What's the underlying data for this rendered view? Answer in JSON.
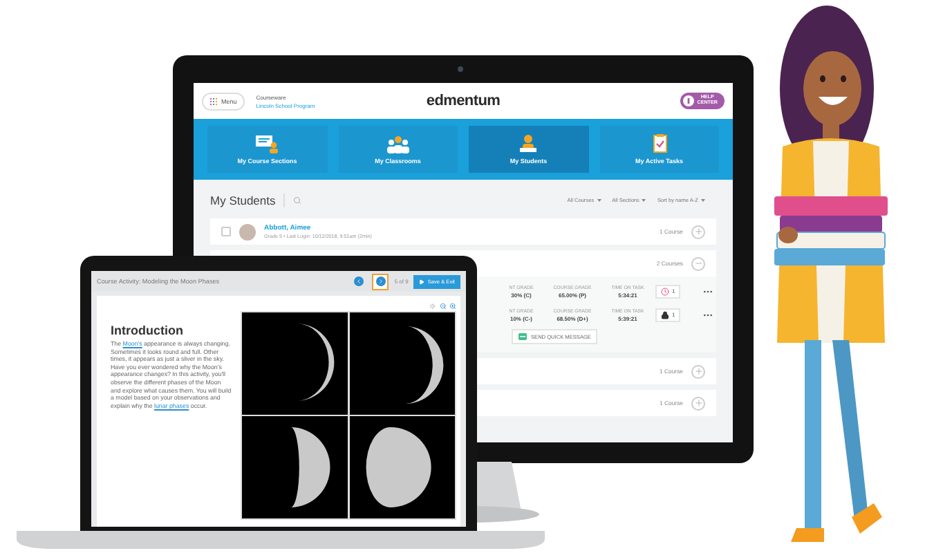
{
  "monitor": {
    "header": {
      "menu_label": "Menu",
      "context_title": "Courseware",
      "context_link": "Lincoln School Program",
      "logo": "edmentum",
      "help_lines": [
        "HELP",
        "CENTER"
      ]
    },
    "nav_tiles": [
      {
        "label": "My Course Sections",
        "kind": "sections",
        "selected": false
      },
      {
        "label": "My Classrooms",
        "kind": "classrooms",
        "selected": false
      },
      {
        "label": "My Students",
        "kind": "students",
        "selected": true
      },
      {
        "label": "My Active Tasks",
        "kind": "tasks",
        "selected": false
      }
    ],
    "section_title": "My Students",
    "filters": [
      "All Courses",
      "All Sections",
      "Sort by name A-Z"
    ],
    "students": [
      {
        "name": "Abbott, Aimee",
        "checked": false,
        "details": "Grade 5 • Last Login: 10/12/2018, 9:51am (2min)",
        "courses": "1 Course",
        "expanded": false
      },
      {
        "courses": "2 Courses",
        "expanded": true,
        "course_rows": [
          {
            "current_header": "NT GRADE",
            "current": "30% (C)",
            "course_header": "COURSE GRADE",
            "course": "65.00% (P)",
            "time_header": "TIME ON TASK",
            "time": "5:34:21",
            "kind": "clock",
            "badge_count": "1"
          },
          {
            "current_header": "NT GRADE",
            "current": "10% (C-)",
            "course_header": "COURSE GRADE",
            "course": "68.50% (D+)",
            "time_header": "TIME ON TASK",
            "time": "5:39:21",
            "kind": "lock",
            "badge_count": "1"
          }
        ],
        "action": "SEND QUICK MESSAGE"
      },
      {
        "courses": "1 Course",
        "expanded": false
      },
      {
        "courses": "1 Course",
        "expanded": false
      }
    ]
  },
  "laptop": {
    "title": "Course Activity: Modeling the Moon Phases",
    "nav_buttons": [
      {
        "kind": "prev",
        "focused": false
      },
      {
        "kind": "next",
        "focused": true
      }
    ],
    "page": "5 of 9",
    "save_label": "Save & Exit",
    "heading": "Introduction",
    "paragraph": [
      {
        "kind": "text",
        "text": "The "
      },
      {
        "kind": "link",
        "text": "Moon's"
      },
      {
        "kind": "text",
        "text": " appearance is always changing. Sometimes it looks round and full. Other times, it appears as just a sliver in the sky. Have you ever wondered why the Moon's appearance changes? In this activity, you'll observe the different phases of the Moon and explore what causes them. You will build a model based on your observations and explain why the "
      },
      {
        "kind": "link",
        "text": "lunar phases"
      },
      {
        "kind": "text",
        "text": " occur."
      }
    ]
  }
}
